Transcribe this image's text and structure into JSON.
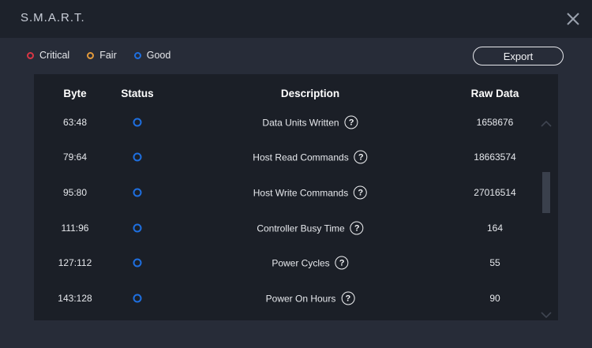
{
  "window": {
    "title": "S.M.A.R.T."
  },
  "legend": [
    {
      "label": "Critical",
      "color": "#d93645"
    },
    {
      "label": "Fair",
      "color": "#e39a3b"
    },
    {
      "label": "Good",
      "color": "#1e6fe0"
    }
  ],
  "export_label": "Export",
  "table": {
    "headers": {
      "byte": "Byte",
      "status": "Status",
      "description": "Description",
      "raw": "Raw Data"
    },
    "rows": [
      {
        "byte": "63:48",
        "status": "Good",
        "description": "Data Units Written",
        "raw": "1658676"
      },
      {
        "byte": "79:64",
        "status": "Good",
        "description": "Host Read Commands",
        "raw": "18663574"
      },
      {
        "byte": "95:80",
        "status": "Good",
        "description": "Host Write Commands",
        "raw": "27016514"
      },
      {
        "byte": "111:96",
        "status": "Good",
        "description": "Controller Busy Time",
        "raw": "164"
      },
      {
        "byte": "127:112",
        "status": "Good",
        "description": "Power Cycles",
        "raw": "55"
      },
      {
        "byte": "143:128",
        "status": "Good",
        "description": "Power On Hours",
        "raw": "90"
      }
    ]
  },
  "icons": {
    "close": "close-icon",
    "help": "question-circle-icon",
    "scroll_up": "chevron-up-icon",
    "scroll_down": "chevron-down-icon"
  }
}
